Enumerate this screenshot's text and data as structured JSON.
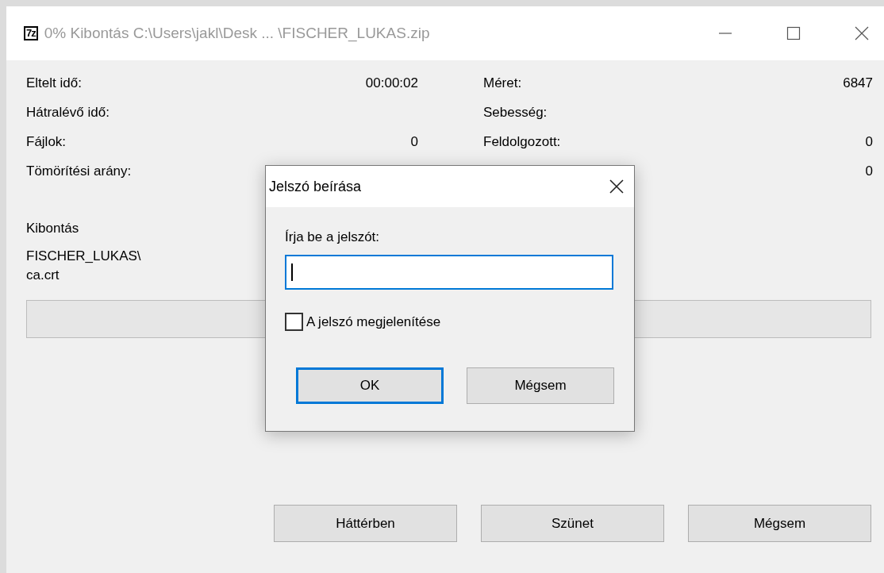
{
  "window": {
    "app_icon": "7z",
    "title": "0% Kibontás C:\\Users\\jakl\\Desk ... \\FISCHER_LUKAS.zip"
  },
  "stats_left": [
    {
      "label": "Eltelt idő:",
      "value": "00:00:02"
    },
    {
      "label": "Hátralévő idő:"
    },
    {
      "label": "Fájlok:",
      "value": "0"
    },
    {
      "label": "Tömörítési arány:"
    }
  ],
  "stats_right": [
    {
      "label": "Méret:",
      "value": "6847"
    },
    {
      "label": "Sebesség:"
    },
    {
      "label": "Feldolgozott:",
      "value": "0"
    },
    {
      "value": "0"
    }
  ],
  "operation": "Kibontás",
  "current_file": [
    "FISCHER_LUKAS\\",
    "ca.crt"
  ],
  "progress": {
    "level": 0
  },
  "buttons": [
    {
      "label": "Háttérben"
    },
    {
      "label": "Szünet"
    },
    {
      "label": "Mégsem"
    }
  ],
  "dialog": {
    "title": "Jelszó beírása",
    "prompt": "Írja be a jelszót:",
    "field": {
      "focused": true
    },
    "checkbox": {
      "label": "A jelszó megjelenítése",
      "checked": false
    },
    "buttons": [
      {
        "label": "OK",
        "default": true
      },
      {
        "label": "Mégsem",
        "default": false
      }
    ]
  }
}
